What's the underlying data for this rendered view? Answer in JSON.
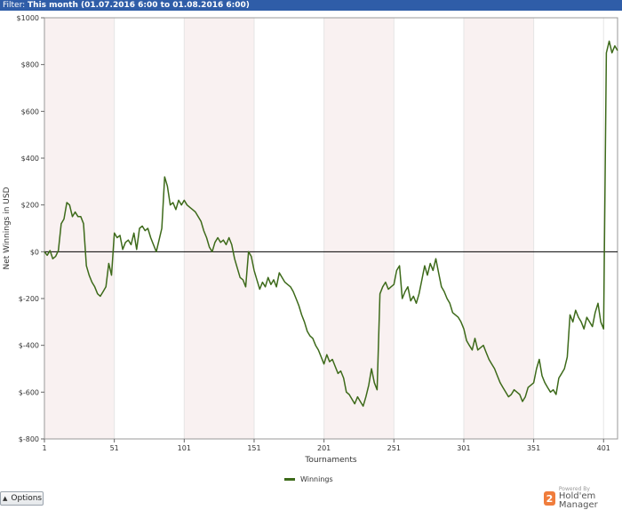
{
  "filter": {
    "label": "Filter:",
    "value": "This month (01.07.2016 6:00 to 01.08.2016 6:00)"
  },
  "options_button": {
    "label": "Options"
  },
  "branding": {
    "powered_by": "Powered By",
    "name": "Hold'em Manager",
    "badge": "2"
  },
  "colors": {
    "series": "#3d6a1a",
    "band": "#f9f1f1",
    "zero_line": "#000000",
    "filter_bar": "#2f5da8"
  },
  "chart_data": {
    "type": "line",
    "xlabel": "Tournaments",
    "ylabel": "Net Winnings in USD",
    "xlim": [
      1,
      411
    ],
    "ylim": [
      -800,
      1000
    ],
    "xticks": [
      1,
      51,
      101,
      151,
      201,
      251,
      301,
      351,
      401
    ],
    "yticks": [
      -800,
      -600,
      -400,
      -200,
      0,
      200,
      400,
      600,
      800,
      1000
    ],
    "ytick_labels": [
      "$-800",
      "$-600",
      "$-400",
      "$-200",
      "$0",
      "$200",
      "$400",
      "$600",
      "$800",
      "$1000"
    ],
    "shaded_bands": [
      [
        1,
        51
      ],
      [
        101,
        151
      ],
      [
        201,
        251
      ],
      [
        301,
        351
      ]
    ],
    "grid": true,
    "legend": "bottom-center",
    "series": [
      {
        "name": "Winnings",
        "points": [
          [
            1,
            0
          ],
          [
            3,
            -15
          ],
          [
            5,
            5
          ],
          [
            7,
            -30
          ],
          [
            9,
            -20
          ],
          [
            11,
            5
          ],
          [
            13,
            120
          ],
          [
            15,
            140
          ],
          [
            17,
            210
          ],
          [
            19,
            200
          ],
          [
            21,
            150
          ],
          [
            23,
            170
          ],
          [
            25,
            150
          ],
          [
            27,
            150
          ],
          [
            29,
            120
          ],
          [
            31,
            -60
          ],
          [
            33,
            -100
          ],
          [
            35,
            -130
          ],
          [
            37,
            -150
          ],
          [
            39,
            -180
          ],
          [
            41,
            -190
          ],
          [
            43,
            -170
          ],
          [
            45,
            -150
          ],
          [
            47,
            -50
          ],
          [
            49,
            -100
          ],
          [
            51,
            80
          ],
          [
            53,
            60
          ],
          [
            55,
            70
          ],
          [
            57,
            10
          ],
          [
            59,
            40
          ],
          [
            61,
            50
          ],
          [
            63,
            30
          ],
          [
            65,
            80
          ],
          [
            67,
            10
          ],
          [
            69,
            100
          ],
          [
            71,
            110
          ],
          [
            73,
            90
          ],
          [
            75,
            100
          ],
          [
            77,
            60
          ],
          [
            79,
            30
          ],
          [
            81,
            0
          ],
          [
            83,
            50
          ],
          [
            85,
            100
          ],
          [
            87,
            320
          ],
          [
            89,
            280
          ],
          [
            91,
            200
          ],
          [
            93,
            210
          ],
          [
            95,
            180
          ],
          [
            97,
            220
          ],
          [
            99,
            200
          ],
          [
            101,
            220
          ],
          [
            103,
            200
          ],
          [
            105,
            190
          ],
          [
            107,
            180
          ],
          [
            109,
            170
          ],
          [
            111,
            150
          ],
          [
            113,
            130
          ],
          [
            115,
            90
          ],
          [
            117,
            60
          ],
          [
            119,
            20
          ],
          [
            121,
            0
          ],
          [
            123,
            40
          ],
          [
            125,
            60
          ],
          [
            127,
            40
          ],
          [
            129,
            50
          ],
          [
            131,
            30
          ],
          [
            133,
            60
          ],
          [
            135,
            30
          ],
          [
            137,
            -30
          ],
          [
            139,
            -70
          ],
          [
            141,
            -110
          ],
          [
            143,
            -120
          ],
          [
            145,
            -150
          ],
          [
            147,
            0
          ],
          [
            149,
            -20
          ],
          [
            151,
            -80
          ],
          [
            153,
            -120
          ],
          [
            155,
            -160
          ],
          [
            157,
            -130
          ],
          [
            159,
            -150
          ],
          [
            161,
            -110
          ],
          [
            163,
            -140
          ],
          [
            165,
            -120
          ],
          [
            167,
            -150
          ],
          [
            169,
            -90
          ],
          [
            171,
            -110
          ],
          [
            173,
            -130
          ],
          [
            175,
            -140
          ],
          [
            177,
            -150
          ],
          [
            179,
            -170
          ],
          [
            181,
            -200
          ],
          [
            183,
            -230
          ],
          [
            185,
            -270
          ],
          [
            187,
            -300
          ],
          [
            189,
            -340
          ],
          [
            191,
            -360
          ],
          [
            193,
            -370
          ],
          [
            195,
            -400
          ],
          [
            197,
            -420
          ],
          [
            199,
            -450
          ],
          [
            201,
            -480
          ],
          [
            203,
            -440
          ],
          [
            205,
            -470
          ],
          [
            207,
            -460
          ],
          [
            209,
            -490
          ],
          [
            211,
            -520
          ],
          [
            213,
            -510
          ],
          [
            215,
            -540
          ],
          [
            217,
            -600
          ],
          [
            219,
            -610
          ],
          [
            221,
            -630
          ],
          [
            223,
            -650
          ],
          [
            225,
            -620
          ],
          [
            227,
            -640
          ],
          [
            229,
            -660
          ],
          [
            231,
            -620
          ],
          [
            233,
            -570
          ],
          [
            235,
            -500
          ],
          [
            237,
            -560
          ],
          [
            239,
            -590
          ],
          [
            241,
            -180
          ],
          [
            243,
            -150
          ],
          [
            245,
            -130
          ],
          [
            247,
            -160
          ],
          [
            249,
            -150
          ],
          [
            251,
            -140
          ],
          [
            253,
            -80
          ],
          [
            255,
            -60
          ],
          [
            257,
            -200
          ],
          [
            259,
            -170
          ],
          [
            261,
            -150
          ],
          [
            263,
            -210
          ],
          [
            265,
            -190
          ],
          [
            267,
            -220
          ],
          [
            269,
            -180
          ],
          [
            271,
            -120
          ],
          [
            273,
            -60
          ],
          [
            275,
            -100
          ],
          [
            277,
            -50
          ],
          [
            279,
            -80
          ],
          [
            281,
            -30
          ],
          [
            283,
            -90
          ],
          [
            285,
            -150
          ],
          [
            287,
            -170
          ],
          [
            289,
            -200
          ],
          [
            291,
            -220
          ],
          [
            293,
            -260
          ],
          [
            295,
            -270
          ],
          [
            297,
            -280
          ],
          [
            299,
            -300
          ],
          [
            301,
            -330
          ],
          [
            303,
            -380
          ],
          [
            305,
            -400
          ],
          [
            307,
            -420
          ],
          [
            309,
            -370
          ],
          [
            311,
            -420
          ],
          [
            313,
            -410
          ],
          [
            315,
            -400
          ],
          [
            317,
            -430
          ],
          [
            319,
            -460
          ],
          [
            321,
            -480
          ],
          [
            323,
            -500
          ],
          [
            325,
            -530
          ],
          [
            327,
            -560
          ],
          [
            329,
            -580
          ],
          [
            331,
            -600
          ],
          [
            333,
            -620
          ],
          [
            335,
            -610
          ],
          [
            337,
            -590
          ],
          [
            339,
            -600
          ],
          [
            341,
            -610
          ],
          [
            343,
            -640
          ],
          [
            345,
            -620
          ],
          [
            347,
            -580
          ],
          [
            349,
            -570
          ],
          [
            351,
            -560
          ],
          [
            353,
            -500
          ],
          [
            355,
            -460
          ],
          [
            357,
            -530
          ],
          [
            359,
            -560
          ],
          [
            361,
            -580
          ],
          [
            363,
            -600
          ],
          [
            365,
            -590
          ],
          [
            367,
            -610
          ],
          [
            369,
            -540
          ],
          [
            371,
            -520
          ],
          [
            373,
            -500
          ],
          [
            375,
            -450
          ],
          [
            377,
            -270
          ],
          [
            379,
            -300
          ],
          [
            381,
            -250
          ],
          [
            383,
            -280
          ],
          [
            385,
            -300
          ],
          [
            387,
            -330
          ],
          [
            389,
            -280
          ],
          [
            391,
            -300
          ],
          [
            393,
            -320
          ],
          [
            395,
            -260
          ],
          [
            397,
            -220
          ],
          [
            399,
            -300
          ],
          [
            401,
            -330
          ],
          [
            403,
            850
          ],
          [
            405,
            900
          ],
          [
            407,
            850
          ],
          [
            409,
            880
          ],
          [
            411,
            860
          ]
        ]
      }
    ]
  }
}
